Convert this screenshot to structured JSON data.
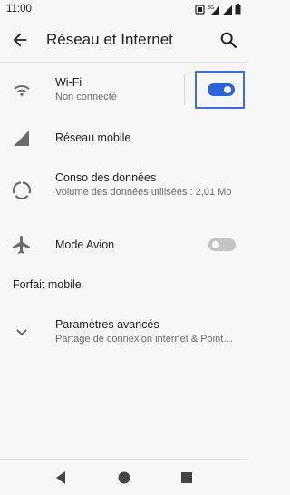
{
  "status_bar": {
    "time": "11:00"
  },
  "header": {
    "title": "Réseau et Internet"
  },
  "items": [
    {
      "label": "Wi-Fi",
      "sub": "Non connecté",
      "toggle": "on"
    },
    {
      "label": "Réseau mobile"
    },
    {
      "label": "Conso des données",
      "sub": "Volume des données utilisées : 2,01 Mo"
    },
    {
      "label": "Mode Avion",
      "toggle": "off"
    }
  ],
  "section": {
    "title": "Forfait mobile"
  },
  "advanced": {
    "label": "Paramètres avancés",
    "sub": "Partage de connexion internet & Point…"
  },
  "colors": {
    "accent": "#2b62d9",
    "highlight_frame": "#3d6fd6"
  }
}
